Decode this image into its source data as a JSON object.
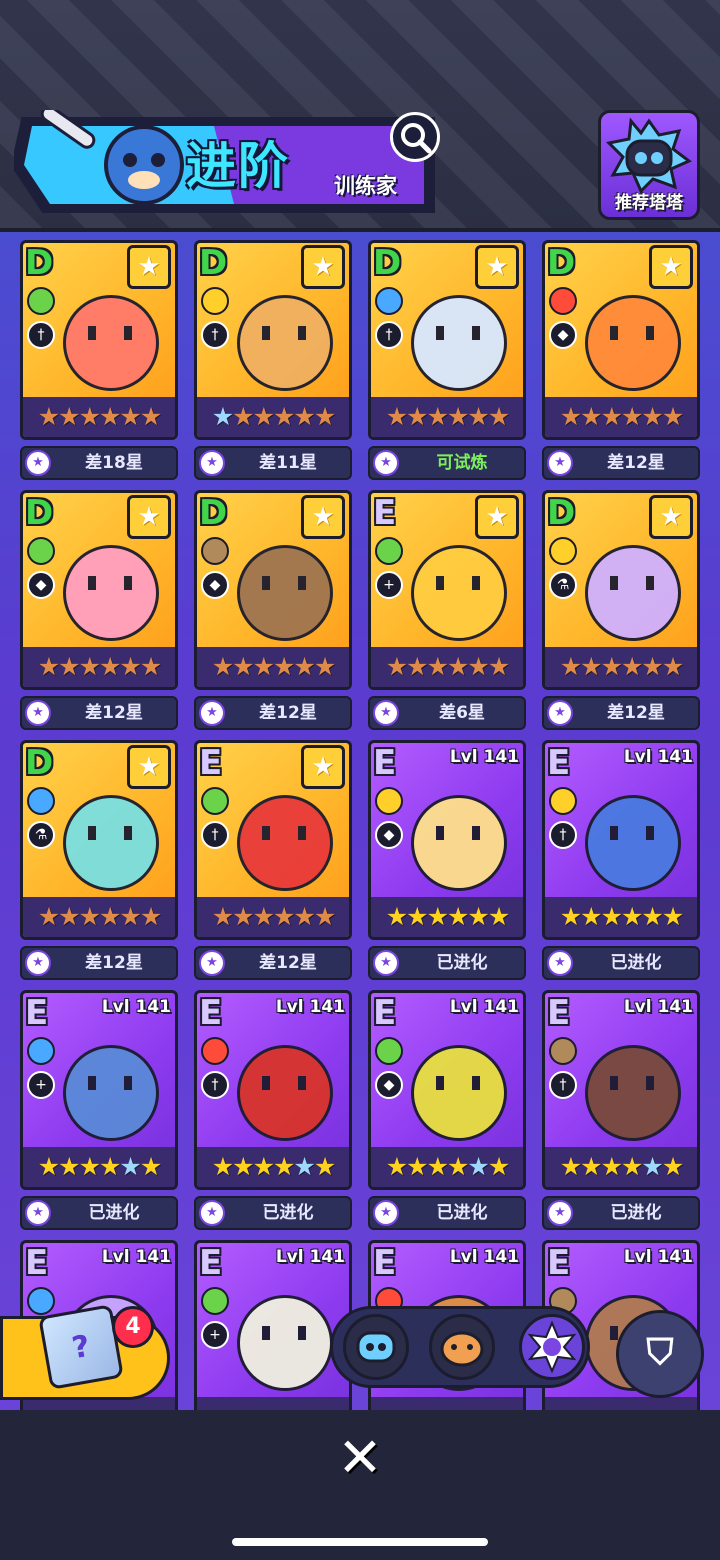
{
  "header": {
    "title": "进阶",
    "subtitle": "训练家",
    "recommend_label": "推荐塔塔"
  },
  "cards": [
    {
      "grade": "D",
      "badge": "star",
      "stars": "bbbbbb",
      "label": "差18星",
      "label_green": false,
      "frame": "gold",
      "element_color": "#6bd34a",
      "creature_color": "#ff7a6b",
      "role_icon": "sword-icon"
    },
    {
      "grade": "D",
      "badge": "star",
      "stars": "sbbbbb",
      "label": "差11星",
      "label_green": false,
      "frame": "gold",
      "element_color": "#ffcf2a",
      "creature_color": "#f0b060",
      "role_icon": "sword-icon"
    },
    {
      "grade": "D",
      "badge": "star",
      "stars": "bbbbbb",
      "label": "可试炼",
      "label_green": true,
      "frame": "gold",
      "element_color": "#49a8ff",
      "creature_color": "#d8e8ff",
      "role_icon": "sword-icon"
    },
    {
      "grade": "D",
      "badge": "star",
      "stars": "bbbbbb",
      "label": "差12星",
      "label_green": false,
      "frame": "gold",
      "element_color": "#ff4b3a",
      "creature_color": "#ff8a3a",
      "role_icon": "shield-icon"
    },
    {
      "grade": "D",
      "badge": "star",
      "stars": "bbbbbb",
      "label": "差12星",
      "label_green": false,
      "frame": "gold",
      "element_color": "#6bd34a",
      "creature_color": "#ff9fc0",
      "role_icon": "shield-icon"
    },
    {
      "grade": "D",
      "badge": "star",
      "stars": "bbbbbb",
      "label": "差12星",
      "label_green": false,
      "frame": "gold",
      "element_color": "#b08a5a",
      "creature_color": "#a07550",
      "role_icon": "shield-icon"
    },
    {
      "grade": "E",
      "badge": "star",
      "stars": "bbbbbb",
      "label": "差6星",
      "label_green": false,
      "frame": "gold",
      "element_color": "#6bd34a",
      "creature_color": "#ffcc40",
      "role_icon": "heal-icon"
    },
    {
      "grade": "D",
      "badge": "star",
      "stars": "bbbbbb",
      "label": "差12星",
      "label_green": false,
      "frame": "gold",
      "element_color": "#ffcf2a",
      "creature_color": "#d0b0ff",
      "role_icon": "potion-icon"
    },
    {
      "grade": "D",
      "badge": "star",
      "stars": "bbbbbb",
      "label": "差12星",
      "label_green": false,
      "frame": "gold",
      "element_color": "#49a8ff",
      "creature_color": "#7adfe0",
      "role_icon": "potion-icon"
    },
    {
      "grade": "E",
      "badge": "star",
      "stars": "bbbbbb",
      "label": "差12星",
      "label_green": false,
      "frame": "gold",
      "element_color": "#6bd34a",
      "creature_color": "#e83a3a",
      "role_icon": "sword-icon"
    },
    {
      "grade": "E",
      "badge": "lvl",
      "level": "Lvl 141",
      "stars": "gggggg",
      "label": "已进化",
      "label_green": false,
      "frame": "purple",
      "element_color": "#ffcf2a",
      "creature_color": "#ffe08a",
      "role_icon": "shield-icon"
    },
    {
      "grade": "E",
      "badge": "lvl",
      "level": "Lvl 141",
      "stars": "gggggg",
      "label": "已进化",
      "label_green": false,
      "frame": "purple",
      "element_color": "#ffcf2a",
      "creature_color": "#4a7ae0",
      "role_icon": "sword-icon"
    },
    {
      "grade": "E",
      "badge": "lvl",
      "level": "Lvl 141",
      "stars": "ggggsg",
      "label": "已进化",
      "label_green": false,
      "frame": "purple",
      "element_color": "#49a8ff",
      "creature_color": "#5a8ad8",
      "role_icon": "heal-icon"
    },
    {
      "grade": "E",
      "badge": "lvl",
      "level": "Lvl 141",
      "stars": "ggggsg",
      "label": "已进化",
      "label_green": false,
      "frame": "purple",
      "element_color": "#ff4b3a",
      "creature_color": "#d8342a",
      "role_icon": "sword-icon"
    },
    {
      "grade": "E",
      "badge": "lvl",
      "level": "Lvl 141",
      "stars": "ggggsg",
      "label": "已进化",
      "label_green": false,
      "frame": "purple",
      "element_color": "#6bd34a",
      "creature_color": "#e8e040",
      "role_icon": "shield-icon"
    },
    {
      "grade": "E",
      "badge": "lvl",
      "level": "Lvl 141",
      "stars": "ggggsg",
      "label": "已进化",
      "label_green": false,
      "frame": "purple",
      "element_color": "#b08a5a",
      "creature_color": "#7a4a3a",
      "role_icon": "sword-icon"
    },
    {
      "grade": "E",
      "badge": "lvl",
      "level": "Lvl 141",
      "stars": "",
      "label": "",
      "label_green": false,
      "frame": "purple",
      "element_color": "#49a8ff",
      "creature_color": "#c8a8ff",
      "role_icon": "sword-icon"
    },
    {
      "grade": "E",
      "badge": "lvl",
      "level": "Lvl 141",
      "stars": "",
      "label": "",
      "label_green": false,
      "frame": "purple",
      "element_color": "#6bd34a",
      "creature_color": "#f0f0e0",
      "role_icon": "heal-icon"
    },
    {
      "grade": "E",
      "badge": "lvl",
      "level": "Lvl 141",
      "stars": "",
      "label": "",
      "label_green": false,
      "frame": "purple",
      "element_color": "#ff4b3a",
      "creature_color": "#e09040",
      "role_icon": "sword-icon"
    },
    {
      "grade": "E",
      "badge": "lvl",
      "level": "Lvl 141",
      "stars": "",
      "label": "",
      "label_green": false,
      "frame": "purple",
      "element_color": "#b08a5a",
      "creature_color": "#b07a50",
      "role_icon": "sword-icon"
    }
  ],
  "gift": {
    "count": "4"
  },
  "toolbar": {
    "filter_icon": "filter-icon"
  },
  "close_icon": "close-icon"
}
